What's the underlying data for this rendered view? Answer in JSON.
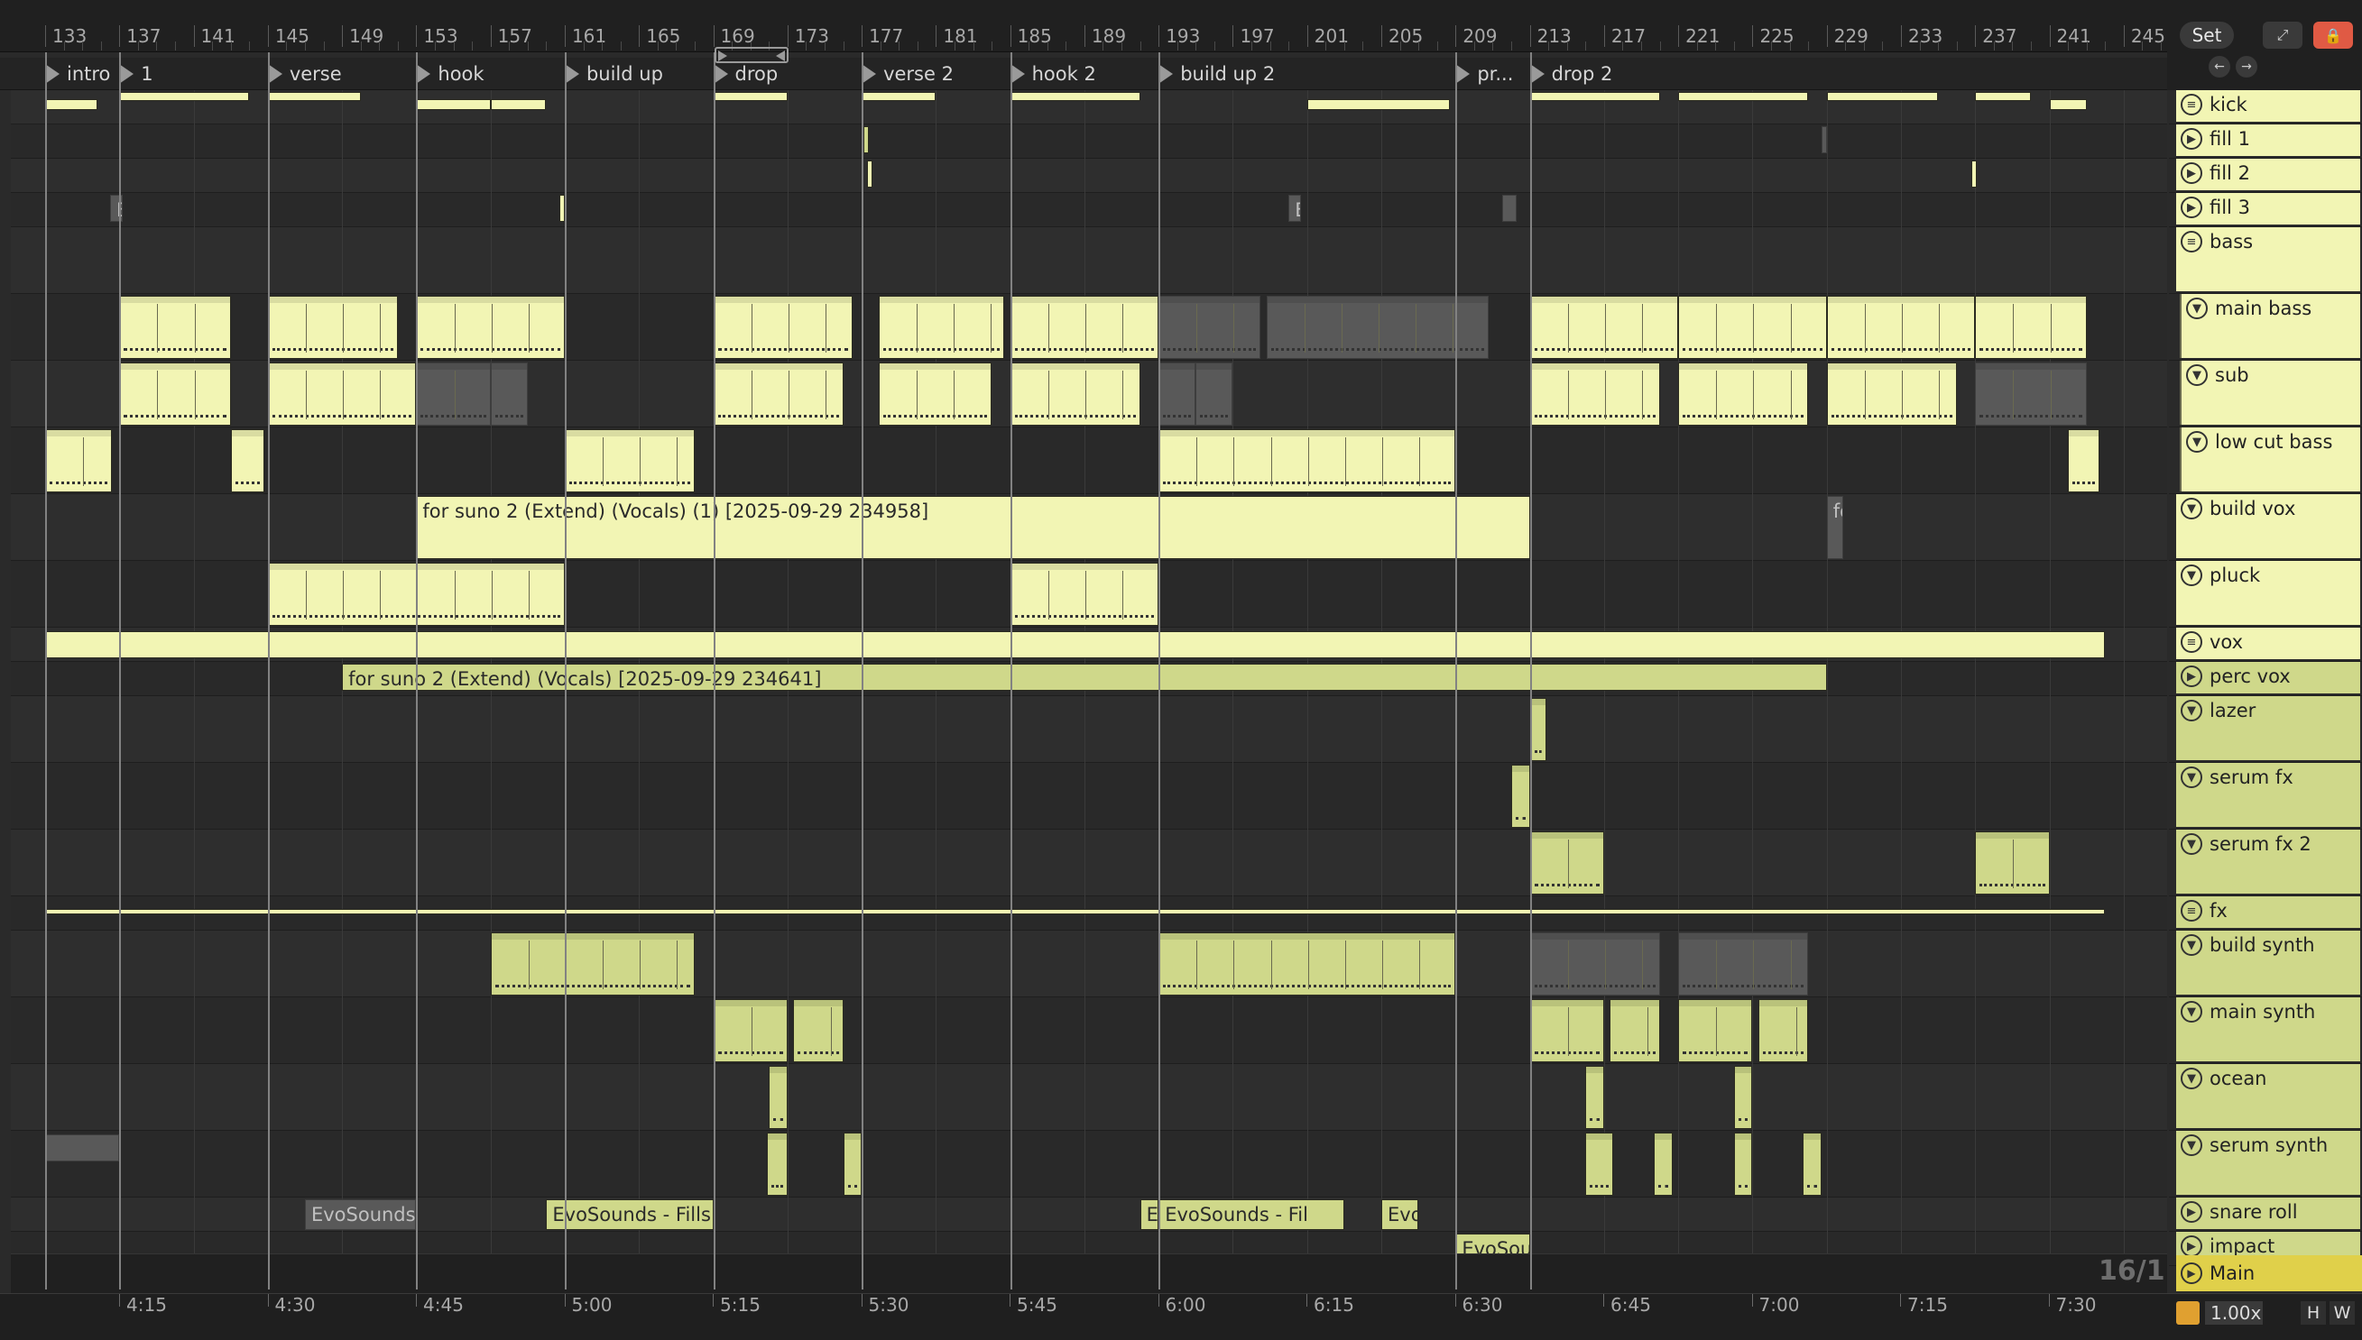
{
  "ruler": {
    "bars": [
      "133",
      "137",
      "141",
      "145",
      "149",
      "153",
      "157",
      "161",
      "165",
      "169",
      "173",
      "177",
      "181",
      "185",
      "189",
      "193",
      "197",
      "201",
      "205",
      "209",
      "213",
      "217",
      "221",
      "225",
      "229",
      "233",
      "237",
      "241",
      "245"
    ]
  },
  "top_buttons": {
    "set_label": "Set"
  },
  "locators": [
    "intro",
    "1",
    "verse",
    "hook",
    "build up",
    "drop",
    "verse 2",
    "hook 2",
    "build up 2",
    "pr...",
    "drop 2"
  ],
  "clip_titles": {
    "build_vox_long": "for suno 2 (Extend) (Vocals) (1) [2025-09-29 234958]",
    "build_vox_stub": "fo",
    "perc_vox_long": "for suno 2 (Extend) (Vocals) [2025-09-29 234641]",
    "snare_roll_1": "EvoSounds -",
    "snare_roll_2": "EvoSounds - Fills -",
    "snare_roll_3": "Ev",
    "snare_roll_4": "EvoSounds - Fil",
    "snare_roll_5": "Evo",
    "impact_1": "EvoSour",
    "kick_fill_marker": "E"
  },
  "tracks": [
    {
      "name": "kick",
      "icon": "list-icon"
    },
    {
      "name": "fill 1",
      "icon": "play-icon"
    },
    {
      "name": "fill 2",
      "icon": "play-icon"
    },
    {
      "name": "fill 3",
      "icon": "play-icon"
    },
    {
      "name": "bass",
      "icon": "list-icon"
    },
    {
      "name": "main bass",
      "icon": "fold-icon"
    },
    {
      "name": "sub",
      "icon": "fold-icon"
    },
    {
      "name": "low cut bass",
      "icon": "fold-icon"
    },
    {
      "name": "build vox",
      "icon": "fold-icon"
    },
    {
      "name": "pluck",
      "icon": "fold-icon"
    },
    {
      "name": "vox",
      "icon": "list-icon"
    },
    {
      "name": "perc vox",
      "icon": "play-icon"
    },
    {
      "name": "lazer",
      "icon": "fold-icon"
    },
    {
      "name": "serum fx",
      "icon": "fold-icon"
    },
    {
      "name": "serum fx 2",
      "icon": "fold-icon"
    },
    {
      "name": "fx",
      "icon": "list-icon"
    },
    {
      "name": "build synth",
      "icon": "fold-icon"
    },
    {
      "name": "main synth",
      "icon": "fold-icon"
    },
    {
      "name": "ocean",
      "icon": "fold-icon"
    },
    {
      "name": "serum synth",
      "icon": "fold-icon"
    },
    {
      "name": "snare roll",
      "icon": "play-icon"
    },
    {
      "name": "impact",
      "icon": "play-icon"
    }
  ],
  "main_track": {
    "name": "Main"
  },
  "grid_label": "16/1",
  "bottom": {
    "times": [
      "4:15",
      "4:30",
      "4:45",
      "5:00",
      "5:15",
      "5:30",
      "5:45",
      "6:00",
      "6:15",
      "6:30",
      "6:45",
      "7:00",
      "7:15",
      "7:30"
    ],
    "zoom": "1.00x",
    "h_label": "H",
    "w_label": "W"
  },
  "colors": {
    "clip_yellow": "#f2f5b4",
    "clip_green": "#cfd88a",
    "clip_gray": "#595959",
    "main_track": "#e0d04a",
    "record_button": "#e05a44"
  }
}
